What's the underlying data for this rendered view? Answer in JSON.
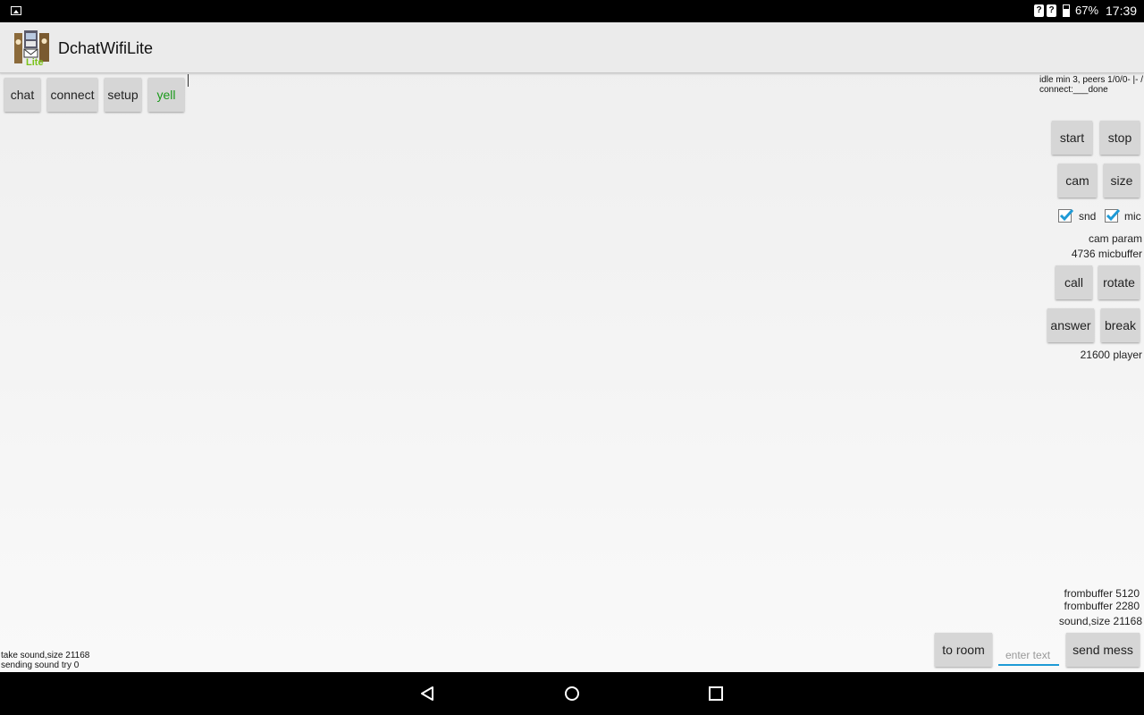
{
  "status_bar": {
    "sim1_label": "?",
    "sim2_label": "?",
    "battery_pct": "67%",
    "time": "17:39"
  },
  "app_bar": {
    "title": "DchatWifiLite",
    "logo_text": "Lite"
  },
  "top_buttons": [
    "chat",
    "connect",
    "setup",
    "yell"
  ],
  "yell_color": "#1a9a1a",
  "status_info": {
    "line1": "idle min 3, peers 1/0/0- |- /",
    "line2": "connect:___done"
  },
  "controls": {
    "start": "start",
    "stop": "stop",
    "cam": "cam",
    "size": "size",
    "snd_label": "snd",
    "snd_checked": true,
    "mic_label": "mic",
    "mic_checked": true,
    "cam_param": "cam param",
    "micbuffer": "4736 micbuffer",
    "call": "call",
    "rotate": "rotate",
    "answer": "answer",
    "break": "break",
    "player": "21600 player"
  },
  "buffers": {
    "line1": "frombuffer 5120",
    "line2": "frombuffer 2280",
    "line3": "sound,size 21168"
  },
  "log": {
    "line1": "take sound,size 21168",
    "line2": "sending sound try 0"
  },
  "bottom": {
    "to_room": "to room",
    "input_placeholder": "enter text",
    "input_value": "",
    "send_mess": "send mess"
  },
  "accent_color": "#1e9ad6",
  "nav_icons": [
    "back-icon",
    "home-icon",
    "recents-icon"
  ]
}
